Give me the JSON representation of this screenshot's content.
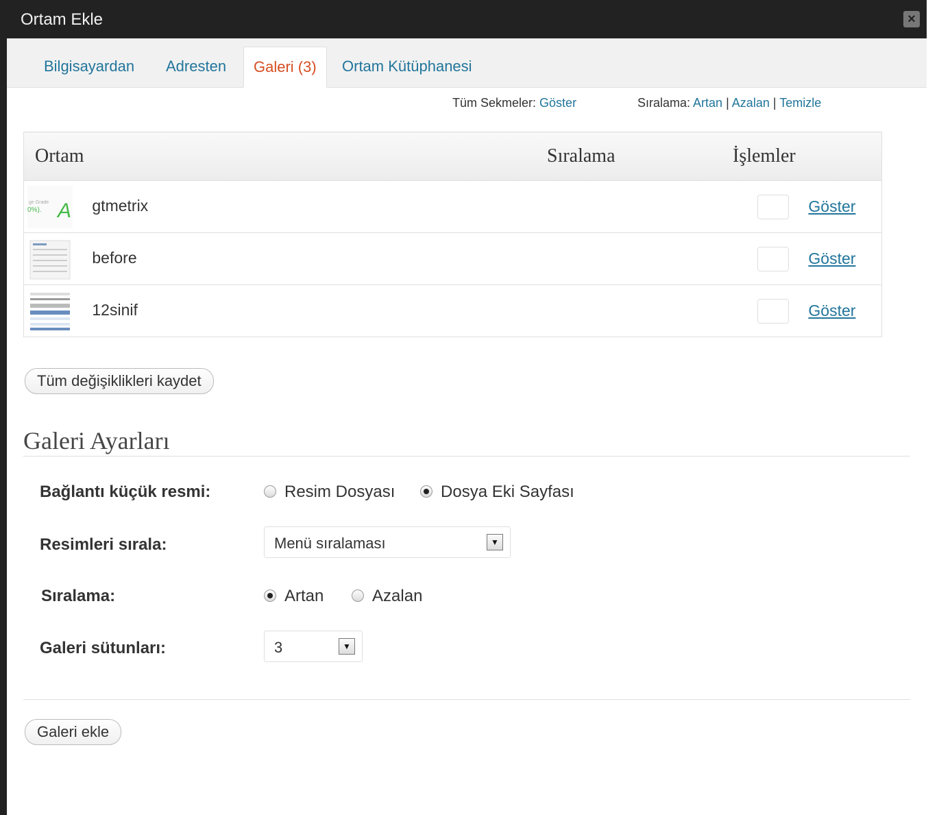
{
  "window": {
    "title": "Ortam Ekle"
  },
  "tabs": [
    {
      "label": "Bilgisayardan"
    },
    {
      "label": "Adresten"
    },
    {
      "label": "Galeri (3)",
      "active": true
    },
    {
      "label": "Ortam Kütüphanesi"
    }
  ],
  "filters": {
    "all_tabs_label": "Tüm Sekmeler:",
    "all_tabs_link": "Göster",
    "sort_label": "Sıralama:",
    "asc": "Artan",
    "desc": "Azalan",
    "clear": "Temizle",
    "separator": "|"
  },
  "table": {
    "headers": [
      "Ortam",
      "Sıralama",
      "İşlemler"
    ],
    "rows": [
      {
        "name": "gtmetrix",
        "action": "Göster"
      },
      {
        "name": "before",
        "action": "Göster"
      },
      {
        "name": "12sinif",
        "action": "Göster"
      }
    ]
  },
  "save_all_label": "Tüm değişiklikleri kaydet",
  "gallery_settings": {
    "title": "Galeri Ayarları",
    "link_thumb": {
      "label": "Bağlantı küçük resmi:",
      "options": [
        "Resim Dosyası",
        "Dosya Eki Sayfası"
      ],
      "selected": "Dosya Eki Sayfası"
    },
    "order_images": {
      "label": "Resimleri sırala:",
      "value": "Menü sıralaması"
    },
    "order": {
      "label": "Sıralama:",
      "options": [
        "Artan",
        "Azalan"
      ],
      "selected": "Artan"
    },
    "columns": {
      "label": "Galeri sütunları:",
      "value": "3"
    }
  },
  "insert_gallery_label": "Galeri ekle",
  "colors": {
    "link": "#21759b",
    "active_tab": "#d54e21",
    "titlebar": "#222222"
  }
}
